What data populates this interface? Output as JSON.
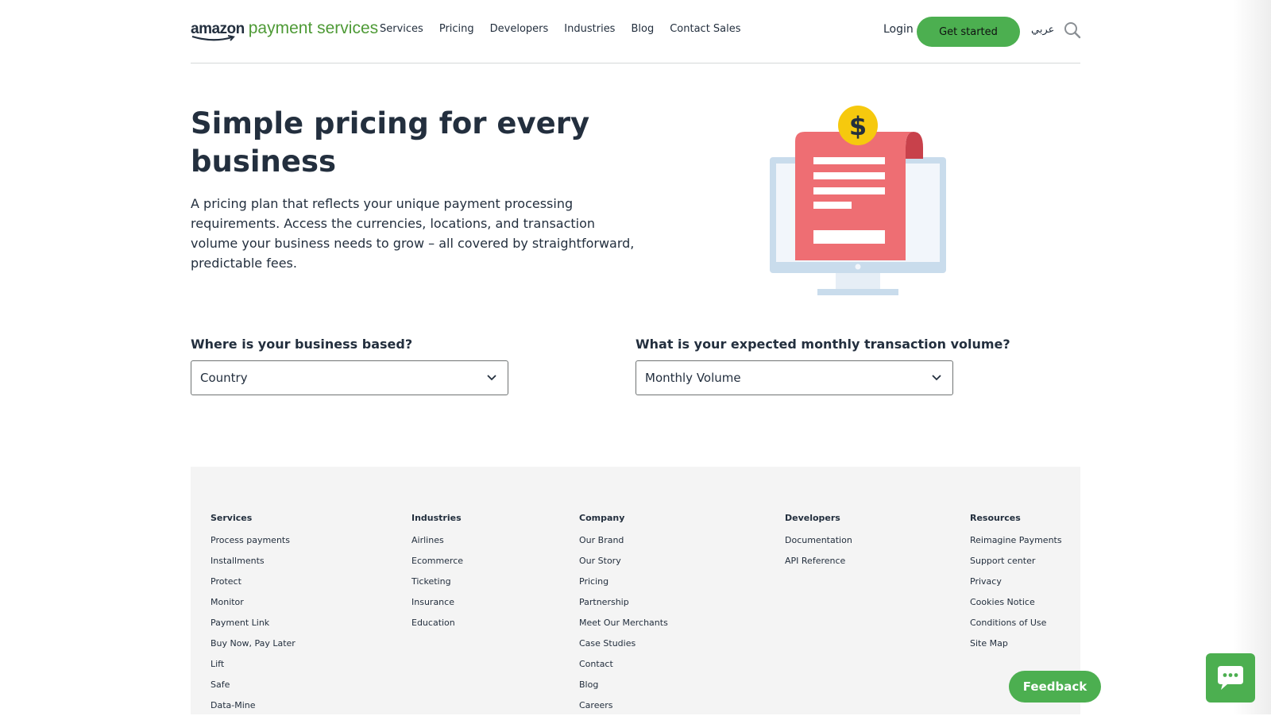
{
  "header": {
    "logo_amazon": "amazon",
    "logo_rest": "payment services",
    "nav": [
      "Services",
      "Pricing",
      "Developers",
      "Industries",
      "Blog",
      "Contact Sales"
    ],
    "login": "Login",
    "get_started": "Get started",
    "language": "عربي",
    "search_icon": "search-icon"
  },
  "hero": {
    "title": "Simple pricing for every business",
    "description": "A pricing plan that reflects your unique payment processing requirements. Access the currencies, locations, and transaction volume your business needs to grow – all covered by straightforward, predictable fees.",
    "illustration_icon": "monitor-invoice-dollar-icon"
  },
  "selectors": {
    "country": {
      "label": "Where is your business based?",
      "value": "Country"
    },
    "volume": {
      "label": "What is your expected monthly transaction volume?",
      "value": "Monthly Volume"
    }
  },
  "footer": {
    "columns": [
      {
        "heading": "Services",
        "links": [
          "Process payments",
          "Installments",
          "Protect",
          "Monitor",
          "Payment Link",
          "Buy Now, Pay Later",
          "Lift",
          "Safe",
          "Data-Mine"
        ]
      },
      {
        "heading": "Industries",
        "links": [
          "Airlines",
          "Ecommerce",
          "Ticketing",
          "Insurance",
          "Education"
        ]
      },
      {
        "heading": "Company",
        "links": [
          "Our Brand",
          "Our Story",
          "Pricing",
          "Partnership",
          "Meet Our Merchants",
          "Case Studies",
          "Contact",
          "Blog",
          "Careers"
        ]
      },
      {
        "heading": "Developers",
        "links": [
          "Documentation",
          "API Reference"
        ]
      },
      {
        "heading": "Resources",
        "links": [
          "Reimagine Payments",
          "Support center",
          "Privacy",
          "Cookies Notice",
          "Conditions of Use",
          "Site Map"
        ]
      }
    ]
  },
  "widgets": {
    "feedback": "Feedback",
    "chat_icon": "chat-bubble-icon"
  },
  "colors": {
    "brand_green": "#4caf50",
    "text_dark": "#232f3e",
    "footer_bg": "#f4f4f4"
  }
}
